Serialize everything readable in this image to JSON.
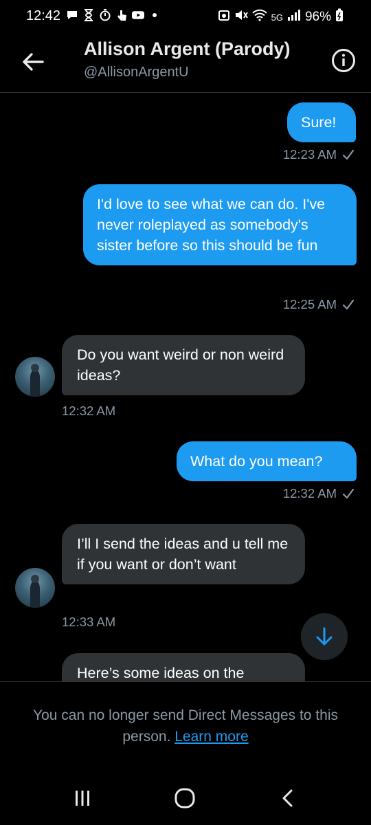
{
  "status_bar": {
    "time": "12:42",
    "battery": "96%",
    "left_icons": [
      "message-icon",
      "hourglass-icon",
      "timer-icon",
      "tap-icon",
      "youtube-icon",
      "dot-icon"
    ],
    "right_icons": [
      "alarm-icon",
      "mute-icon",
      "wifi-icon",
      "5g-icon",
      "signal-icon",
      "battery-icon"
    ]
  },
  "header": {
    "title": "Allison Argent (Parody)",
    "handle": "@AllisonArgentU"
  },
  "messages": [
    {
      "direction": "out",
      "text": "Sure!",
      "time": "12:23 AM"
    },
    {
      "direction": "out",
      "text": "I'd love to see what we can do. I've never roleplayed as somebody's sister before so this should be fun",
      "time": "12:25 AM"
    },
    {
      "direction": "in",
      "text": "Do you want weird or non weird ideas?",
      "time": "12:32 AM"
    },
    {
      "direction": "out",
      "text": "What do you mean?",
      "time": "12:32 AM"
    },
    {
      "direction": "in",
      "text": "I’ll I send the ideas and u tell me if you want or don’t want",
      "time": "12:33 AM"
    },
    {
      "direction": "in",
      "text": "Here’s some ideas on the",
      "time": ""
    }
  ],
  "footer": {
    "notice": "You can no longer send Direct Messages to this person.",
    "link": "Learn more"
  },
  "colors": {
    "accent": "#1d9bf0",
    "incoming_bubble": "#2f3336",
    "background": "#000000",
    "muted_text": "#8b98a5"
  }
}
